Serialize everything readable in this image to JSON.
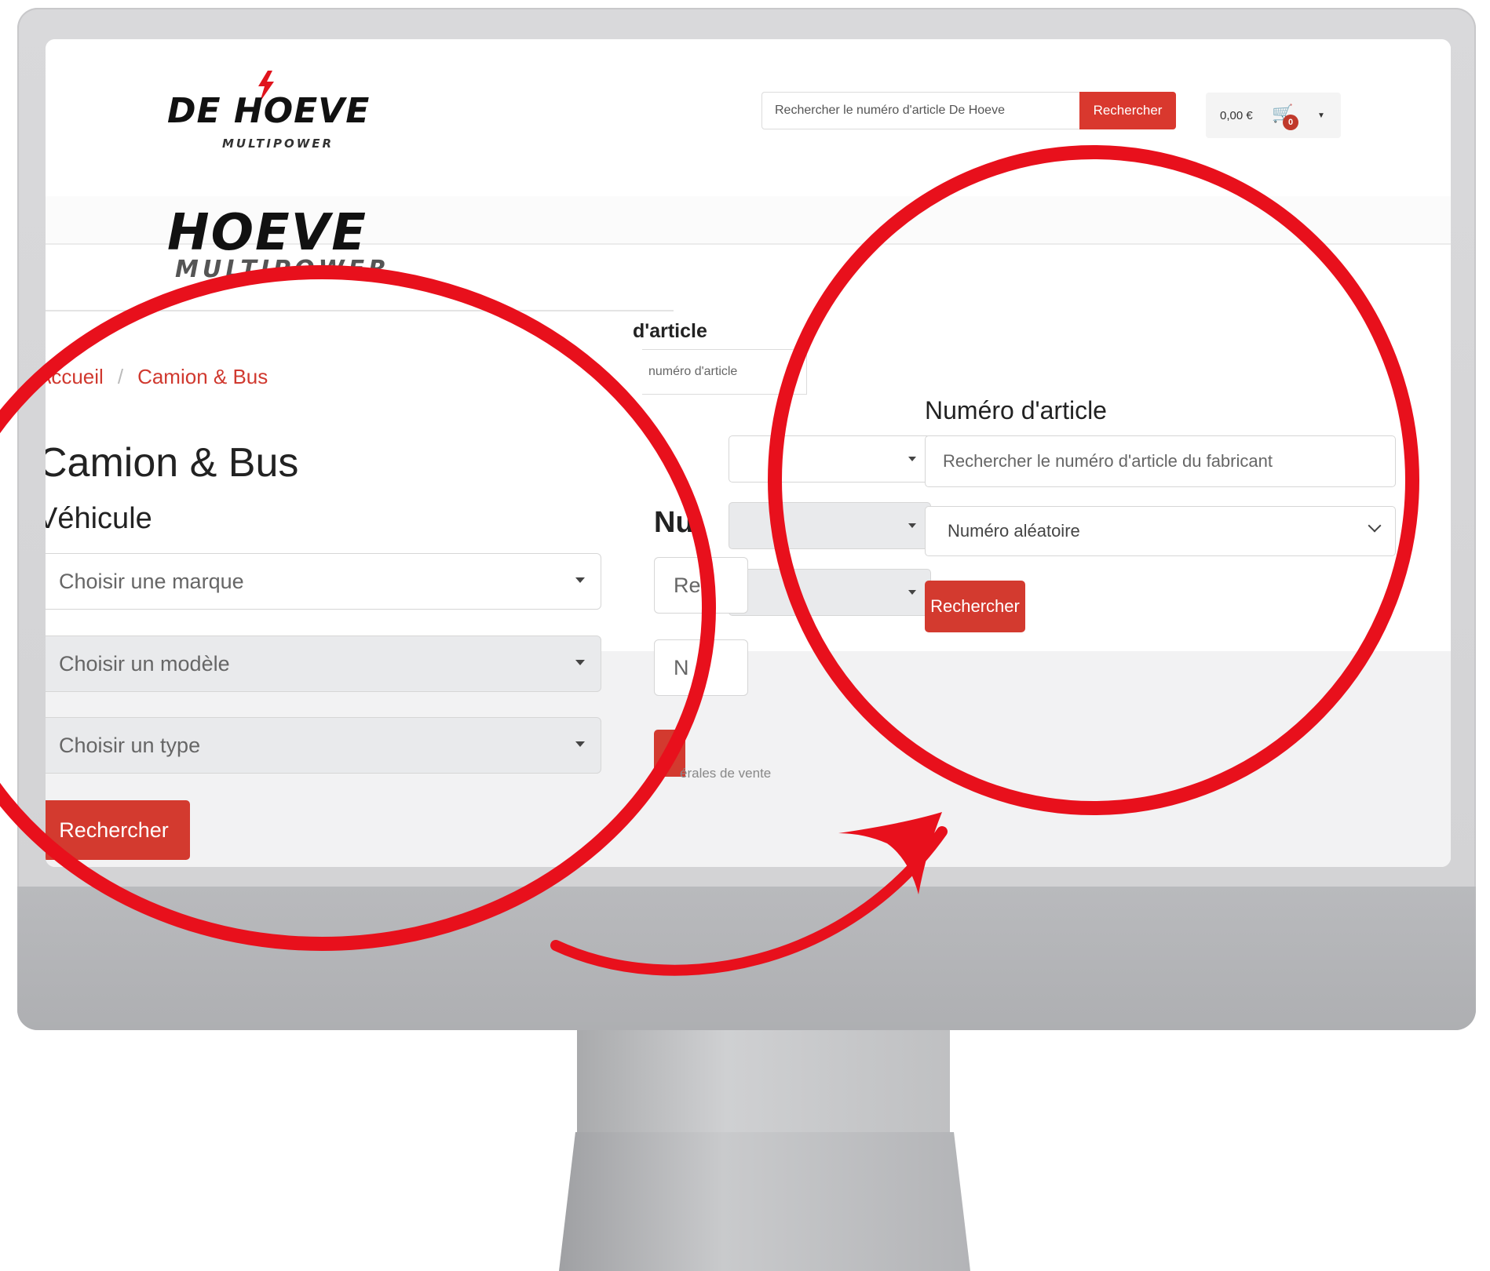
{
  "header": {
    "logo": {
      "line1": "DE HOEVE",
      "line2": "MULTIPOWER"
    },
    "search": {
      "placeholder": "Rechercher le numéro d'article De Hoeve",
      "button_label": "Rechercher"
    },
    "cart": {
      "total": "0,00 €",
      "badge_count": "0",
      "icon": "cart-icon"
    }
  },
  "zoomed_logo": {
    "line1": "HOEVE",
    "line2": "MULTIPOWER"
  },
  "breadcrumb": {
    "items": [
      "Accueil",
      "Camion & Bus"
    ]
  },
  "main": {
    "title": "Camion & Bus",
    "vehicle": {
      "section_title": "Véhicule",
      "brand_select": "Choisir une marque",
      "model_select": "Choisir un modèle",
      "type_select": "Choisir un type",
      "search_button": "Rechercher"
    }
  },
  "partial": {
    "article_heading_fragment": "d'article",
    "article_input_fragment": "numéro d'article",
    "section_fragment": "Nu",
    "input_fragment": "Re",
    "select_fragment": "N",
    "cgv_fragment": "érales de vente"
  },
  "article_search": {
    "title": "Numéro d'article",
    "input_placeholder": "Rechercher le numéro d'article du fabricant",
    "select_value": "Numéro aléatoire",
    "button_label": "Rechercher"
  },
  "colors": {
    "accent": "#d33a2f",
    "highlight_ring": "#e8101c"
  }
}
